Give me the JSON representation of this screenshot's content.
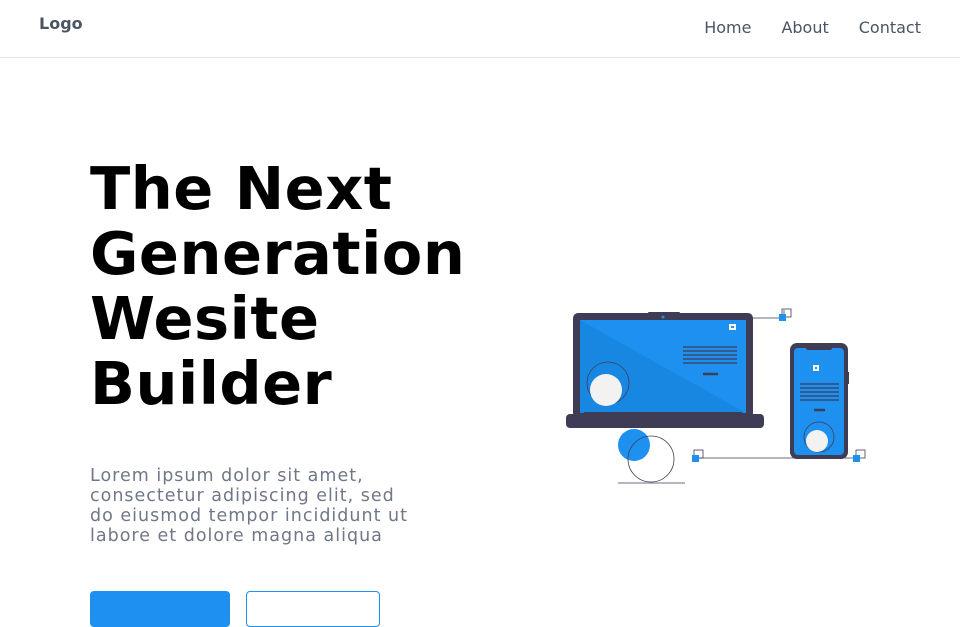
{
  "nav": {
    "logo": "Logo",
    "links": [
      "Home",
      "About",
      "Contact"
    ]
  },
  "hero": {
    "title": "The Next Generation Wesite Builder",
    "description": "Lorem ipsum dolor sit amet, consectetur adipiscing elit, sed do eiusmod tempor incididunt ut labore et dolore magna aliqua",
    "primary_button": "",
    "secondary_button": ""
  },
  "colors": {
    "accent": "#1e90f0",
    "device_frame": "#3f3d56",
    "text_muted": "#707787"
  },
  "illustration": "laptop-and-phone-illustration"
}
